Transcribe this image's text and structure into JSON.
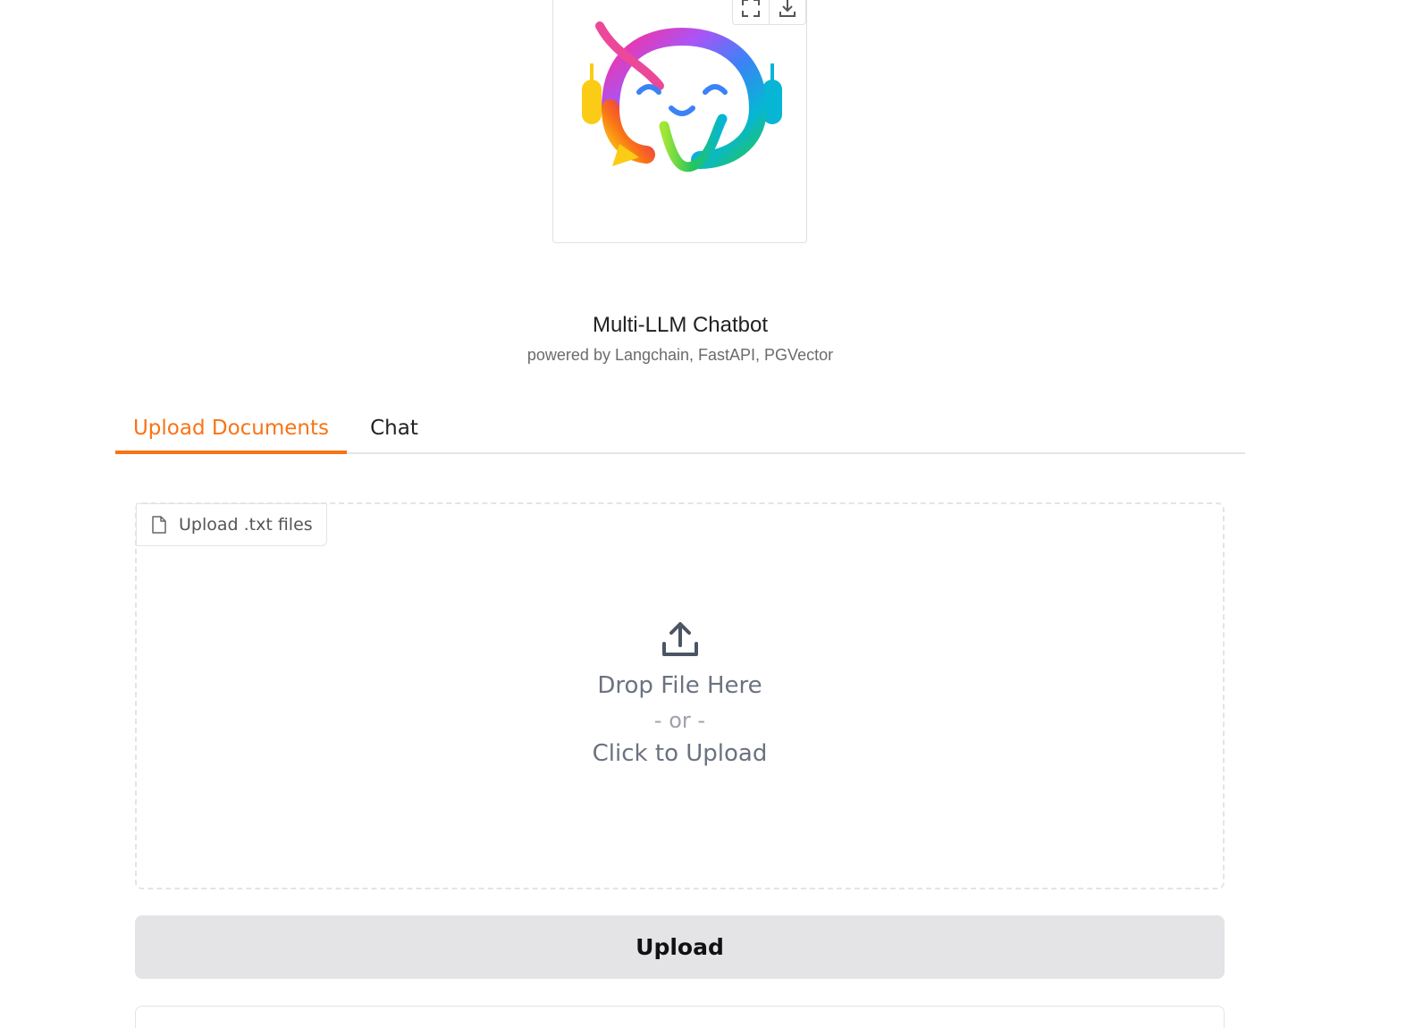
{
  "header": {
    "title": "Multi-LLM Chatbot",
    "subtitle": "powered by Langchain, FastAPI, PGVector"
  },
  "logo": {
    "icon": "chatbot-logo-icon",
    "toolbar": [
      "fullscreen-icon",
      "download-icon"
    ]
  },
  "tabs": [
    {
      "label": "Upload Documents",
      "active": true
    },
    {
      "label": "Chat",
      "active": false
    }
  ],
  "upload": {
    "label": "Upload .txt files",
    "drop_text": "Drop File Here",
    "or_text": "- or -",
    "click_text": "Click to Upload",
    "button_label": "Upload"
  },
  "colors": {
    "accent": "#f97316",
    "button_bg": "#e4e4e7"
  }
}
